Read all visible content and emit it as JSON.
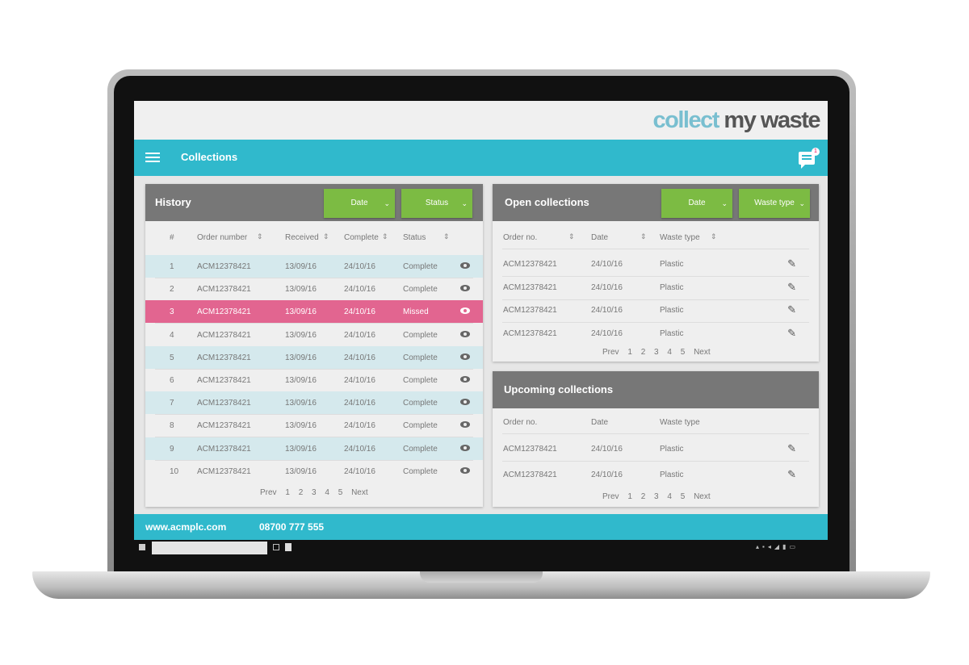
{
  "brand": {
    "word1": "collect",
    "word2": "my waste"
  },
  "nav": {
    "title": "Collections",
    "notification_count": "1"
  },
  "history": {
    "title": "History",
    "filters": [
      "Date",
      "Status"
    ],
    "columns": [
      "#",
      "Order number",
      "Received",
      "Complete",
      "Status"
    ],
    "rows": [
      {
        "n": "1",
        "order": "ACM12378421",
        "received": "13/09/16",
        "complete": "24/10/16",
        "status": "Complete"
      },
      {
        "n": "2",
        "order": "ACM12378421",
        "received": "13/09/16",
        "complete": "24/10/16",
        "status": "Complete"
      },
      {
        "n": "3",
        "order": "ACM12378421",
        "received": "13/09/16",
        "complete": "24/10/16",
        "status": "Missed"
      },
      {
        "n": "4",
        "order": "ACM12378421",
        "received": "13/09/16",
        "complete": "24/10/16",
        "status": "Complete"
      },
      {
        "n": "5",
        "order": "ACM12378421",
        "received": "13/09/16",
        "complete": "24/10/16",
        "status": "Complete"
      },
      {
        "n": "6",
        "order": "ACM12378421",
        "received": "13/09/16",
        "complete": "24/10/16",
        "status": "Complete"
      },
      {
        "n": "7",
        "order": "ACM12378421",
        "received": "13/09/16",
        "complete": "24/10/16",
        "status": "Complete"
      },
      {
        "n": "8",
        "order": "ACM12378421",
        "received": "13/09/16",
        "complete": "24/10/16",
        "status": "Complete"
      },
      {
        "n": "9",
        "order": "ACM12378421",
        "received": "13/09/16",
        "complete": "24/10/16",
        "status": "Complete"
      },
      {
        "n": "10",
        "order": "ACM12378421",
        "received": "13/09/16",
        "complete": "24/10/16",
        "status": "Complete"
      }
    ],
    "pagination": [
      "Prev",
      "1",
      "2",
      "3",
      "4",
      "5",
      "Next"
    ]
  },
  "open": {
    "title": "Open collections",
    "filters": [
      "Date",
      "Waste type"
    ],
    "columns": [
      "Order no.",
      "Date",
      "Waste type"
    ],
    "rows": [
      {
        "order": "ACM12378421",
        "date": "24/10/16",
        "type": "Plastic"
      },
      {
        "order": "ACM12378421",
        "date": "24/10/16",
        "type": "Plastic"
      },
      {
        "order": "ACM12378421",
        "date": "24/10/16",
        "type": "Plastic"
      },
      {
        "order": "ACM12378421",
        "date": "24/10/16",
        "type": "Plastic"
      }
    ],
    "pagination": [
      "Prev",
      "1",
      "2",
      "3",
      "4",
      "5",
      "Next"
    ]
  },
  "upcoming": {
    "title": "Upcoming collections",
    "columns": [
      "Order no.",
      "Date",
      "Waste type"
    ],
    "rows": [
      {
        "order": "ACM12378421",
        "date": "24/10/16",
        "type": "Plastic"
      },
      {
        "order": "ACM12378421",
        "date": "24/10/16",
        "type": "Plastic"
      }
    ],
    "pagination": [
      "Prev",
      "1",
      "2",
      "3",
      "4",
      "5",
      "Next"
    ]
  },
  "footer": {
    "website": "www.acmplc.com",
    "phone": "08700 777 555"
  },
  "colors": {
    "accent": "#30b9cc",
    "button": "#7cbb43",
    "missed": "#e26590",
    "header": "#777777"
  }
}
